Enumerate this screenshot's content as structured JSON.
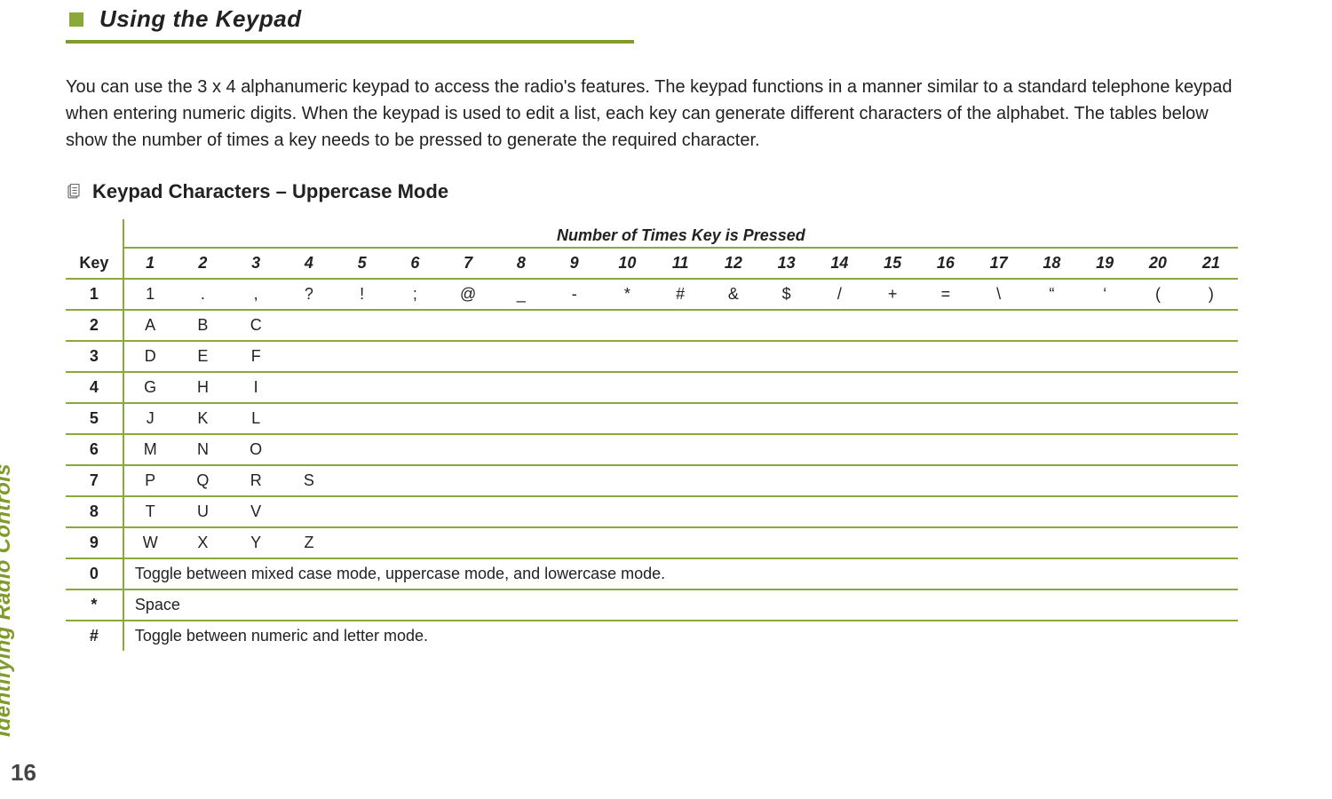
{
  "page_number": "16",
  "side_label": "Identifying Radio Controls",
  "heading": "Using the Keypad",
  "intro": "You can use the 3 x 4 alphanumeric keypad to access the radio's features. The keypad functions in a manner similar to a standard telephone keypad when entering numeric digits. When the keypad is used to edit a list, each key can generate different characters of the alphabet. The tables below show the number of times a key needs to be pressed to generate the required character.",
  "subheading": "Keypad Characters – Uppercase Mode",
  "table": {
    "key_header": "Key",
    "super_header": "Number of Times Key is Pressed",
    "press_counts": [
      "1",
      "2",
      "3",
      "4",
      "5",
      "6",
      "7",
      "8",
      "9",
      "10",
      "11",
      "12",
      "13",
      "14",
      "15",
      "16",
      "17",
      "18",
      "19",
      "20",
      "21"
    ],
    "rows": [
      {
        "key": "1",
        "cells": [
          "1",
          ".",
          ",",
          "?",
          "!",
          ";",
          "@",
          "_",
          "-",
          "*",
          "#",
          "&",
          "$",
          "/",
          "+",
          "=",
          "\\",
          "“",
          "‘",
          "(",
          ")"
        ]
      },
      {
        "key": "2",
        "cells": [
          "A",
          "B",
          "C"
        ]
      },
      {
        "key": "3",
        "cells": [
          "D",
          "E",
          "F"
        ]
      },
      {
        "key": "4",
        "cells": [
          "G",
          "H",
          "I"
        ]
      },
      {
        "key": "5",
        "cells": [
          "J",
          "K",
          "L"
        ]
      },
      {
        "key": "6",
        "cells": [
          "M",
          "N",
          "O"
        ]
      },
      {
        "key": "7",
        "cells": [
          "P",
          "Q",
          "R",
          "S"
        ]
      },
      {
        "key": "8",
        "cells": [
          "T",
          "U",
          "V"
        ]
      },
      {
        "key": "9",
        "cells": [
          "W",
          "X",
          "Y",
          "Z"
        ]
      },
      {
        "key": "0",
        "span_text": "Toggle between mixed case mode, uppercase mode, and lowercase mode."
      },
      {
        "key": "*",
        "span_text": "Space"
      },
      {
        "key": "#",
        "span_text": "Toggle between numeric and letter mode."
      }
    ]
  }
}
